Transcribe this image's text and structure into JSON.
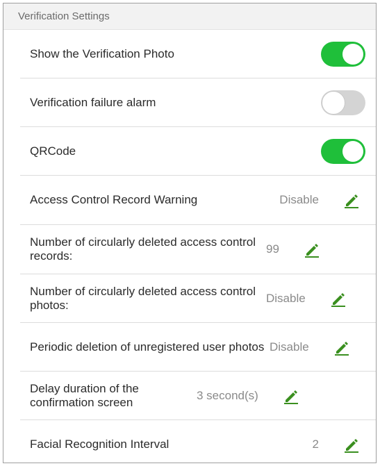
{
  "section": {
    "title": "Verification Settings"
  },
  "toggles": [
    {
      "label": "Show the Verification Photo",
      "on": true
    },
    {
      "label": "Verification failure alarm",
      "on": false
    },
    {
      "label": "QRCode",
      "on": true
    }
  ],
  "settings": [
    {
      "label": "Access Control Record Warning",
      "value": "Disable"
    },
    {
      "label": "Number of circularly deleted access control records:",
      "value": "99"
    },
    {
      "label": "Number of circularly deleted access control photos:",
      "value": "Disable"
    },
    {
      "label": "Periodic deletion of unregistered user photos",
      "value": "Disable"
    },
    {
      "label": "Delay duration of the confirmation screen",
      "value": "3 second(s)"
    },
    {
      "label": "Facial Recognition Interval",
      "value": "2"
    }
  ],
  "colors": {
    "accent": "#1fbf3a",
    "toggle_off": "#d4d4d4"
  },
  "icons": {
    "edit": "pencil-icon"
  }
}
